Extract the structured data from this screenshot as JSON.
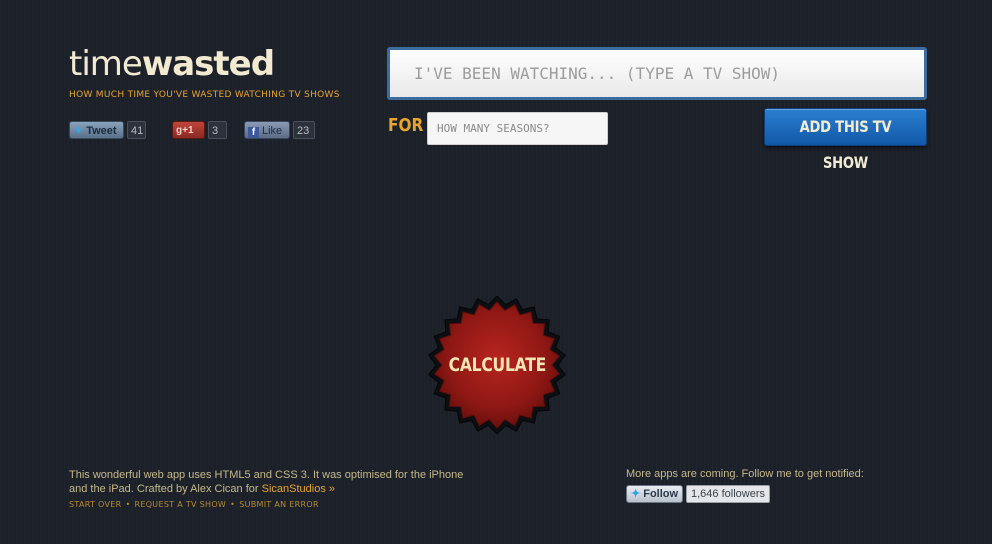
{
  "header": {
    "logo_light": "time",
    "logo_bold": "wasted",
    "tagline": "HOW MUCH TIME YOU'VE WASTED WATCHING TV SHOWS"
  },
  "social": {
    "tweet_label": "Tweet",
    "tweet_count": "41",
    "gplus_label": "+1",
    "gplus_count": "3",
    "like_label": "Like",
    "like_count": "23"
  },
  "form": {
    "show_placeholder": "I'VE BEEN WATCHING... (TYPE A TV SHOW)",
    "for_label": "FOR",
    "seasons_placeholder": "HOW MANY SEASONS?",
    "add_button": "ADD THIS TV SHOW"
  },
  "calculate": {
    "label": "CALCULATE"
  },
  "footer": {
    "description": "This wonderful web app uses HTML5 and CSS 3. It was optimised for the iPhone and the iPad. Crafted by Alex Cican for ",
    "credit_link": "SicanStudios »",
    "links": [
      "START OVER",
      "REQUEST A TV SHOW",
      "SUBMIT AN ERROR"
    ],
    "separator": "•",
    "more_apps": "More apps are coming. Follow me to get notified:",
    "follow_label": "Follow",
    "followers": "1,646 followers"
  },
  "colors": {
    "background": "#1c2029",
    "accent_orange": "#e8a42c",
    "logo_cream": "#f2ead0",
    "button_blue": "#1e6cbf",
    "seal_red": "#9e1c1a"
  },
  "icons": {
    "tweet": "twitter-bird-icon",
    "gplus": "google-plus-icon",
    "like": "facebook-icon",
    "follow": "twitter-bird-icon"
  }
}
